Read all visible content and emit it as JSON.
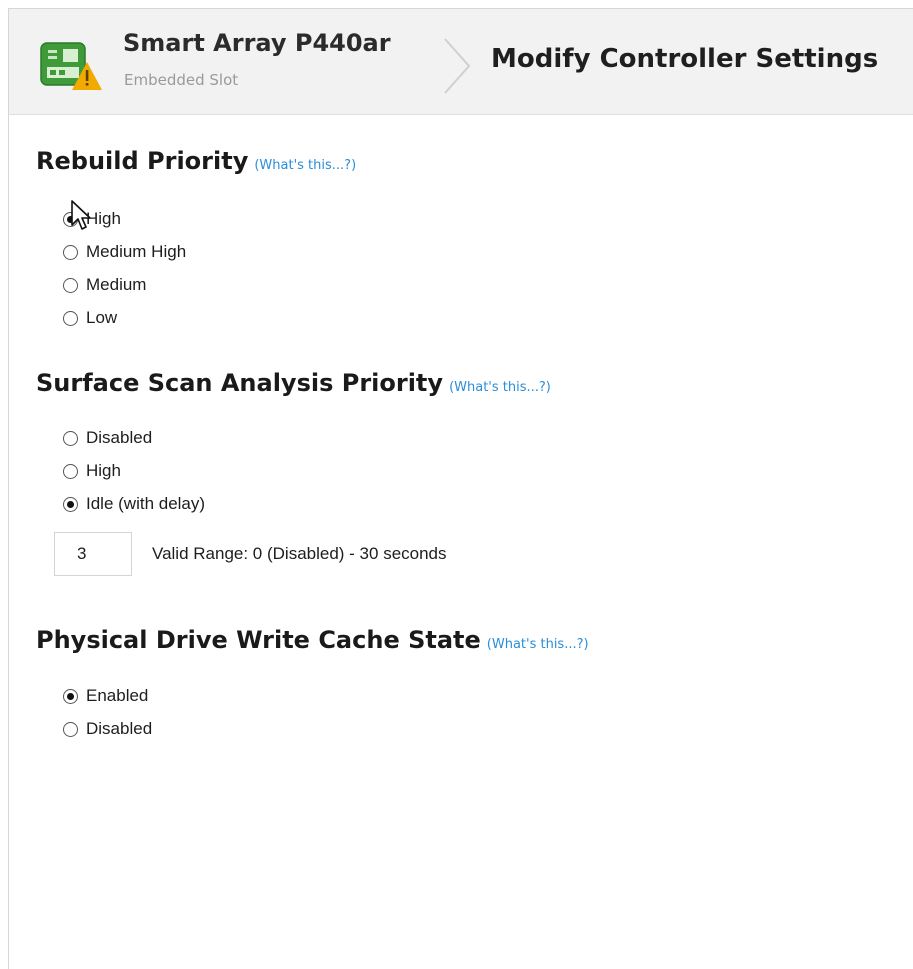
{
  "header": {
    "controller_name": "Smart Array P440ar",
    "controller_slot": "Embedded Slot",
    "page_title": "Modify Controller Settings"
  },
  "help_link_text": "(What's this...?)",
  "rebuild_priority": {
    "title": "Rebuild Priority",
    "options": [
      {
        "label": "High",
        "selected": true
      },
      {
        "label": "Medium High",
        "selected": false
      },
      {
        "label": "Medium",
        "selected": false
      },
      {
        "label": "Low",
        "selected": false
      }
    ]
  },
  "surface_scan": {
    "title": "Surface Scan Analysis Priority",
    "options": [
      {
        "label": "Disabled",
        "selected": false
      },
      {
        "label": "High",
        "selected": false
      },
      {
        "label": "Idle (with delay)",
        "selected": true
      }
    ],
    "delay_value": "3",
    "valid_range": "Valid Range: 0 (Disabled) - 30 seconds"
  },
  "write_cache": {
    "title": "Physical Drive Write Cache State",
    "options": [
      {
        "label": "Enabled",
        "selected": true
      },
      {
        "label": "Disabled",
        "selected": false
      }
    ]
  },
  "icons": {
    "controller": "controller-warning-icon",
    "separator": "chevron-right-icon",
    "pointer": "mouse-cursor-icon"
  },
  "colors": {
    "header_bg": "#f2f2f2",
    "help_link": "#2b8ed8",
    "warning": "#f2a900",
    "icon_green": "#3f9b3a"
  }
}
